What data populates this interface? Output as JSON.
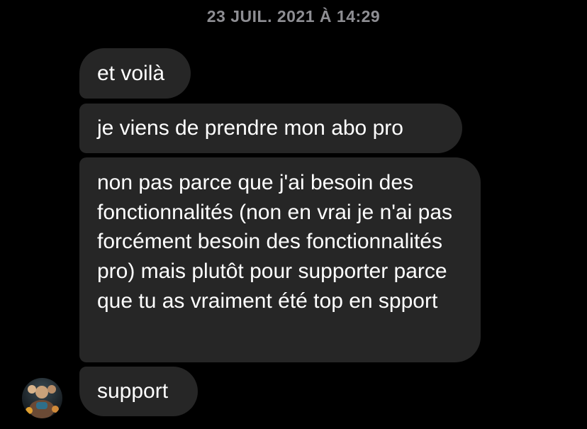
{
  "conversation": {
    "timestamp": "23 JUIL. 2021 À 14:29",
    "messages": [
      {
        "text": "et voilà"
      },
      {
        "text": "je viens de prendre mon abo pro"
      },
      {
        "text": "non pas parce que j'ai besoin des fonctionnalités (non en vrai je n'ai pas forcément besoin des fonctionnalités pro) mais plutôt pour supporter parce que tu as vraiment été top en spport"
      },
      {
        "text": "support"
      }
    ],
    "sender": {
      "avatar_icon": "profile-photo-avatar"
    }
  },
  "colors": {
    "background": "#000000",
    "bubble": "#262626",
    "timestamp": "#8e8e93",
    "message_text": "#ffffff"
  }
}
